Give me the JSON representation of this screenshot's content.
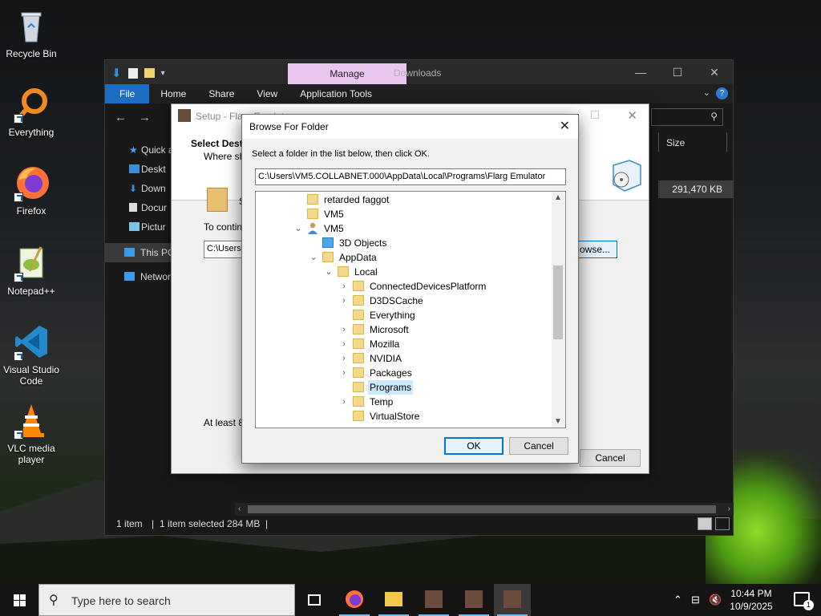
{
  "desktop": {
    "icons": [
      {
        "label": "Recycle Bin",
        "icon": "recycle-bin-icon"
      },
      {
        "label": "Everything",
        "icon": "everything-icon"
      },
      {
        "label": "Firefox",
        "icon": "firefox-icon"
      },
      {
        "label": "Notepad++",
        "icon": "notepad-plus-plus-icon"
      },
      {
        "label": "Visual Studio Code",
        "icon": "vscode-icon"
      },
      {
        "label": "VLC media player",
        "icon": "vlc-icon"
      }
    ]
  },
  "explorer": {
    "title": "Downloads",
    "manage_tab": "Manage",
    "ribbon_tabs": [
      "File",
      "Home",
      "Share",
      "View",
      "Application Tools"
    ],
    "nav": [
      "Quick a",
      "Deskt",
      "Down",
      "Docur",
      "Pictur",
      "This PC",
      "Networ"
    ],
    "column_size": "Size",
    "file_size": "291,470 KB",
    "status": {
      "items": "1 item",
      "selected": "1 item selected  284 MB",
      "sep": "|"
    }
  },
  "setup": {
    "title": "Setup - Flarg Emulator",
    "heading": "Select Dest",
    "subheading": "Where sho",
    "folder_letter": "S",
    "to_continue": "To continu",
    "path_value": "C:\\Users\\",
    "browse_label": "owse...",
    "at_least": "At least 8",
    "cancel_label": "Cancel"
  },
  "browse_dialog": {
    "title": "Browse For Folder",
    "instruction": "Select a folder in the list below, then click OK.",
    "path": "C:\\Users\\VM5.COLLABNET.000\\AppData\\Local\\Programs\\Flarg Emulator",
    "tree": [
      {
        "label": "retarded faggot",
        "depth": 0,
        "expander": "",
        "icon": "folder"
      },
      {
        "label": "VM5",
        "depth": 0,
        "expander": "",
        "icon": "folder"
      },
      {
        "label": "VM5",
        "depth": 0,
        "expander": "⌄",
        "icon": "user"
      },
      {
        "label": "3D Objects",
        "depth": 1,
        "expander": "",
        "icon": "3d"
      },
      {
        "label": "AppData",
        "depth": 1,
        "expander": "⌄",
        "icon": "folder"
      },
      {
        "label": "Local",
        "depth": 2,
        "expander": "⌄",
        "icon": "folder"
      },
      {
        "label": "ConnectedDevicesPlatform",
        "depth": 3,
        "expander": "›",
        "icon": "folder"
      },
      {
        "label": "D3DSCache",
        "depth": 3,
        "expander": "›",
        "icon": "folder"
      },
      {
        "label": "Everything",
        "depth": 3,
        "expander": "",
        "icon": "folder"
      },
      {
        "label": "Microsoft",
        "depth": 3,
        "expander": "›",
        "icon": "folder"
      },
      {
        "label": "Mozilla",
        "depth": 3,
        "expander": "›",
        "icon": "folder"
      },
      {
        "label": "NVIDIA",
        "depth": 3,
        "expander": "›",
        "icon": "folder"
      },
      {
        "label": "Packages",
        "depth": 3,
        "expander": "›",
        "icon": "folder"
      },
      {
        "label": "Programs",
        "depth": 3,
        "expander": "",
        "icon": "folder",
        "selected": true
      },
      {
        "label": "Temp",
        "depth": 3,
        "expander": "›",
        "icon": "folder"
      },
      {
        "label": "VirtualStore",
        "depth": 3,
        "expander": "",
        "icon": "folder"
      }
    ],
    "ok_label": "OK",
    "cancel_label": "Cancel"
  },
  "taskbar": {
    "search_placeholder": "Type here to search",
    "time": "10:44 PM",
    "date": "10/9/2025",
    "notification_count": "1"
  }
}
